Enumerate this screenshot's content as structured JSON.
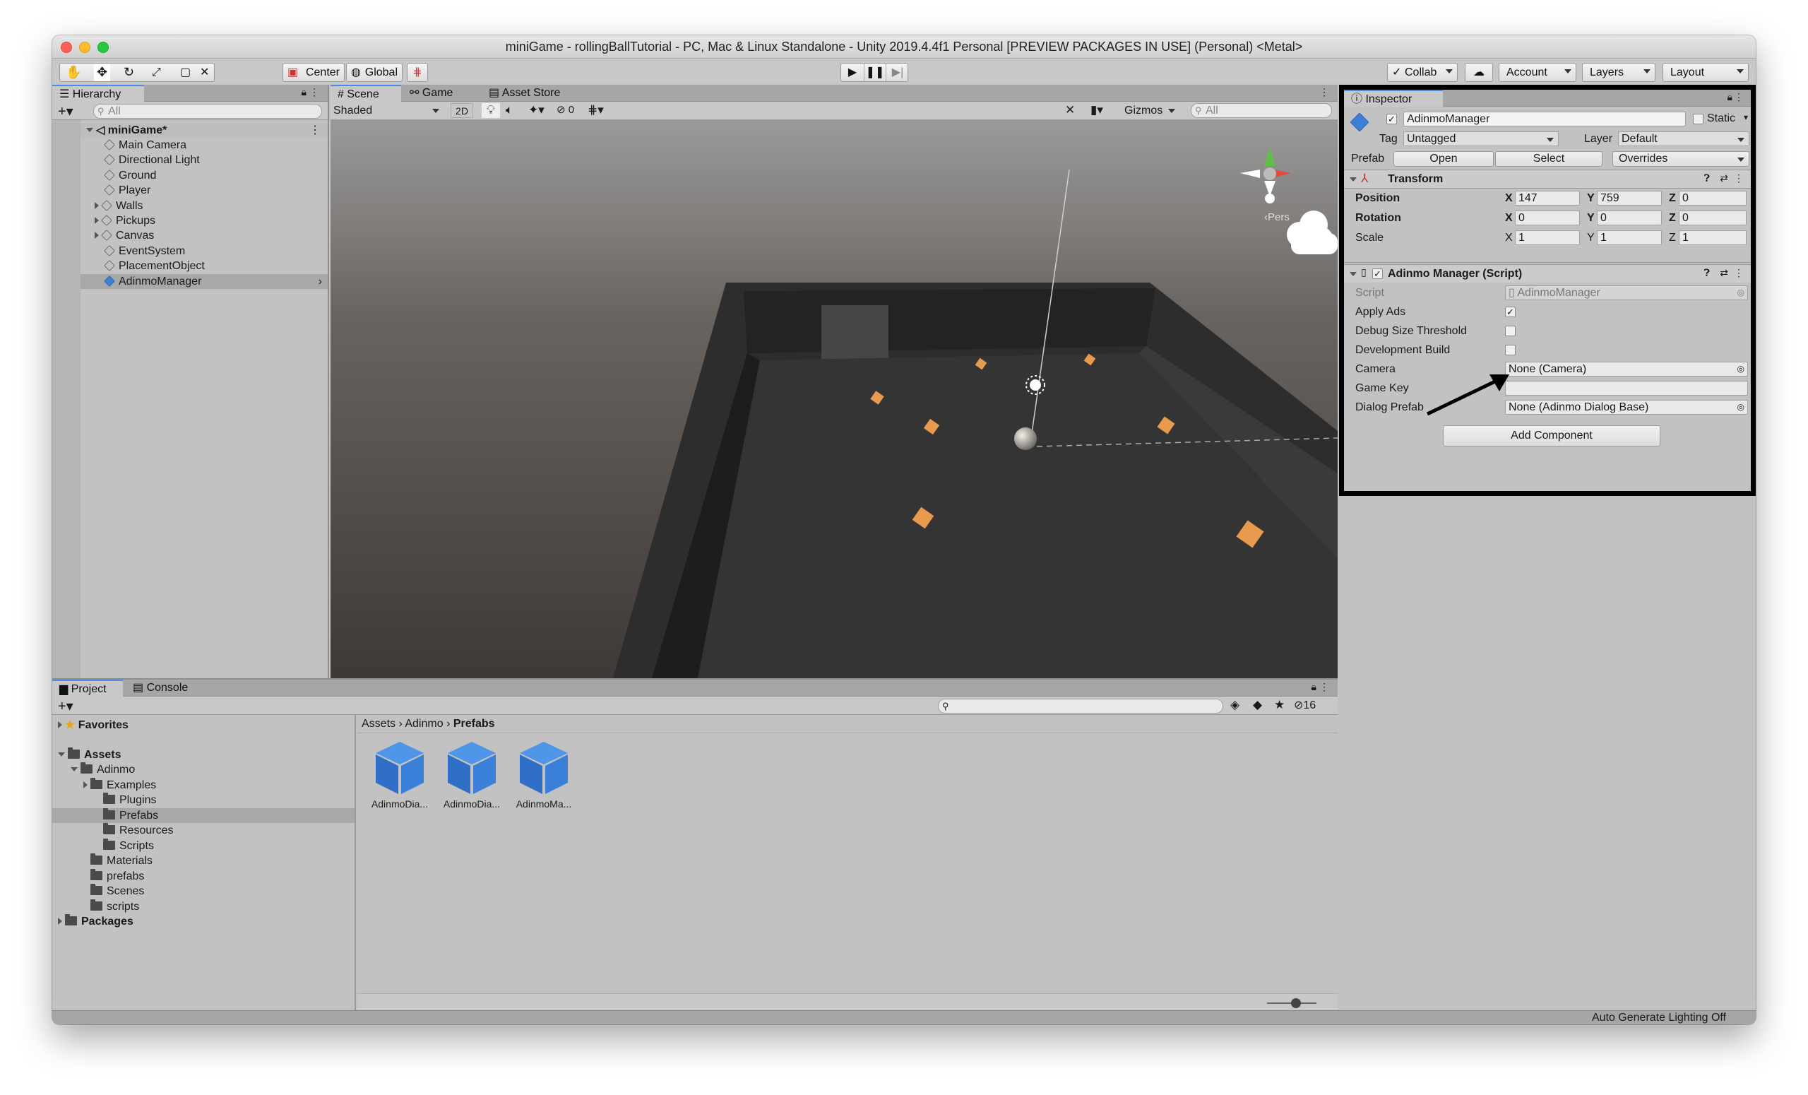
{
  "window": {
    "title": "miniGame - rollingBallTutorial - PC, Mac & Linux Standalone - Unity 2019.4.4f1 Personal [PREVIEW PACKAGES IN USE] (Personal) <Metal>"
  },
  "toolbar": {
    "pivot": "Center",
    "space": "Global",
    "collab": "Collab",
    "account": "Account",
    "layers": "Layers",
    "layout": "Layout"
  },
  "hierarchy": {
    "tab": "Hierarchy",
    "search_placeholder": "All",
    "scene": "miniGame*",
    "items": [
      {
        "label": "Main Camera"
      },
      {
        "label": "Directional Light"
      },
      {
        "label": "Ground"
      },
      {
        "label": "Player"
      },
      {
        "label": "Walls"
      },
      {
        "label": "Pickups"
      },
      {
        "label": "Canvas"
      },
      {
        "label": "EventSystem"
      },
      {
        "label": "PlacementObject"
      },
      {
        "label": "AdinmoManager"
      }
    ]
  },
  "scene_view": {
    "tabs": [
      "Scene",
      "Game",
      "Asset Store"
    ],
    "draw_mode": "Shaded",
    "mode_2d": "2D",
    "hidden_count": "0",
    "gizmos": "Gizmos",
    "search_placeholder": "All",
    "persp_label": "‹Pers"
  },
  "project": {
    "tabs": [
      "Project",
      "Console"
    ],
    "count": "16",
    "breadcrumb": [
      "Assets",
      "Adinmo",
      "Prefabs"
    ],
    "tree": [
      {
        "label": "Favorites"
      },
      {
        "label": "Assets"
      },
      {
        "label": "Adinmo"
      },
      {
        "label": "Examples"
      },
      {
        "label": "Plugins"
      },
      {
        "label": "Prefabs"
      },
      {
        "label": "Resources"
      },
      {
        "label": "Scripts"
      },
      {
        "label": "Materials"
      },
      {
        "label": "prefabs"
      },
      {
        "label": "Scenes"
      },
      {
        "label": "scripts"
      },
      {
        "label": "Packages"
      }
    ],
    "assets": [
      {
        "label": "AdinmoDia..."
      },
      {
        "label": "AdinmoDia..."
      },
      {
        "label": "AdinmoMa..."
      }
    ]
  },
  "inspector": {
    "tab": "Inspector",
    "object_name": "AdinmoManager",
    "static_label": "Static",
    "tag_label": "Tag",
    "tag_value": "Untagged",
    "layer_label": "Layer",
    "layer_value": "Default",
    "prefab_label": "Prefab",
    "prefab_open": "Open",
    "prefab_select": "Select",
    "prefab_overrides": "Overrides",
    "transform": {
      "title": "Transform",
      "position_label": "Position",
      "rotation_label": "Rotation",
      "scale_label": "Scale",
      "position": {
        "x": "147",
        "y": "759",
        "z": "0"
      },
      "rotation": {
        "x": "0",
        "y": "0",
        "z": "0"
      },
      "scale": {
        "x": "1",
        "y": "1",
        "z": "1"
      }
    },
    "script_component": {
      "title": "Adinmo Manager (Script)",
      "script_label": "Script",
      "script_value": "AdinmoManager",
      "apply_ads_label": "Apply Ads",
      "debug_size_label": "Debug Size Threshold",
      "dev_build_label": "Development Build",
      "camera_label": "Camera",
      "camera_value": "None (Camera)",
      "game_key_label": "Game Key",
      "game_key_value": "",
      "dialog_prefab_label": "Dialog Prefab",
      "dialog_prefab_value": "None (Adinmo Dialog Base)"
    },
    "add_component": "Add Component"
  },
  "statusbar": {
    "text": "Auto Generate Lighting Off"
  }
}
